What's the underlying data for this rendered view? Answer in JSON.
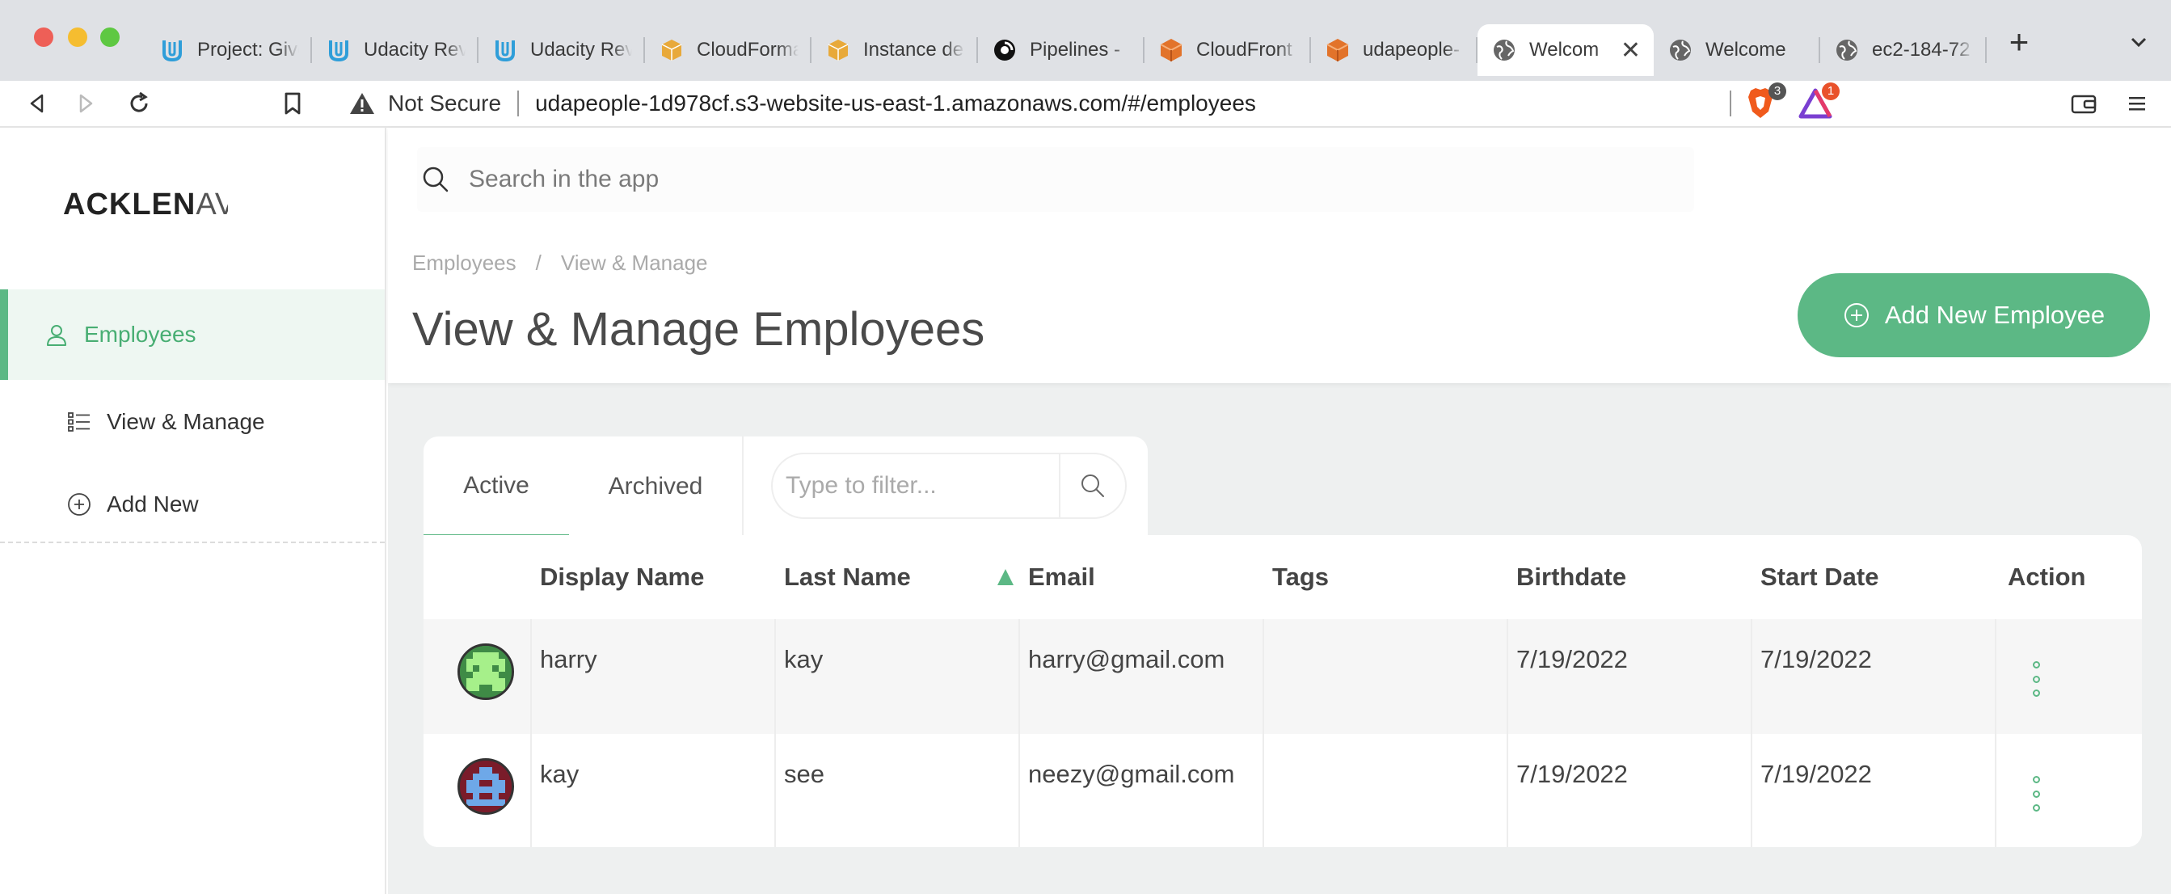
{
  "browser": {
    "tabs": [
      {
        "label": "Project: Give",
        "icon": "udacity-icon"
      },
      {
        "label": "Udacity Rev",
        "icon": "udacity-icon"
      },
      {
        "label": "Udacity Rev",
        "icon": "udacity-icon"
      },
      {
        "label": "CloudForma",
        "icon": "aws-box-icon"
      },
      {
        "label": "Instance de",
        "icon": "aws-box-icon"
      },
      {
        "label": "Pipelines - ",
        "icon": "circleci-icon"
      },
      {
        "label": "CloudFront",
        "icon": "aws-cube-icon"
      },
      {
        "label": "udapeople-",
        "icon": "aws-cube-icon"
      },
      {
        "label": "Welcom",
        "icon": "globe-icon",
        "active": true
      },
      {
        "label": "Welcome",
        "icon": "globe-icon"
      },
      {
        "label": "ec2-184-72",
        "icon": "globe-icon"
      }
    ],
    "security_label": "Not Secure",
    "url": "udapeople-1d978cf.s3-website-us-east-1.amazonaws.com/#/employees",
    "brave_badge": "3",
    "rewards_badge": "1"
  },
  "sidebar": {
    "logo_main": "ACKLEN",
    "logo_fade": "AV",
    "items": [
      {
        "label": "Employees",
        "icon": "user-icon",
        "active": true
      },
      {
        "label": "View & Manage",
        "icon": "list-icon"
      },
      {
        "label": "Add New",
        "icon": "plus-circle-icon"
      }
    ]
  },
  "header": {
    "search_placeholder": "Search in the app",
    "breadcrumb": [
      "Employees",
      "/",
      "View & Manage"
    ],
    "title": "View & Manage Employees",
    "add_button": "Add New Employee"
  },
  "tabs": {
    "active": "Active",
    "archived": "Archived",
    "filter_placeholder": "Type to filter..."
  },
  "table": {
    "columns": [
      "Display Name",
      "Last Name",
      "Email",
      "Tags",
      "Birthdate",
      "Start Date",
      "Action"
    ],
    "rows": [
      {
        "display_name": "harry",
        "last_name": "kay",
        "email": "harry@gmail.com",
        "tags": "",
        "birthdate": "7/19/2022",
        "start_date": "7/19/2022"
      },
      {
        "display_name": "kay",
        "last_name": "see",
        "email": "neezy@gmail.com",
        "tags": "",
        "birthdate": "7/19/2022",
        "start_date": "7/19/2022"
      }
    ]
  },
  "colors": {
    "accent": "#5cb885",
    "avatar1_bg": "#3f8b46",
    "avatar2_bg": "#7a1c2a"
  }
}
